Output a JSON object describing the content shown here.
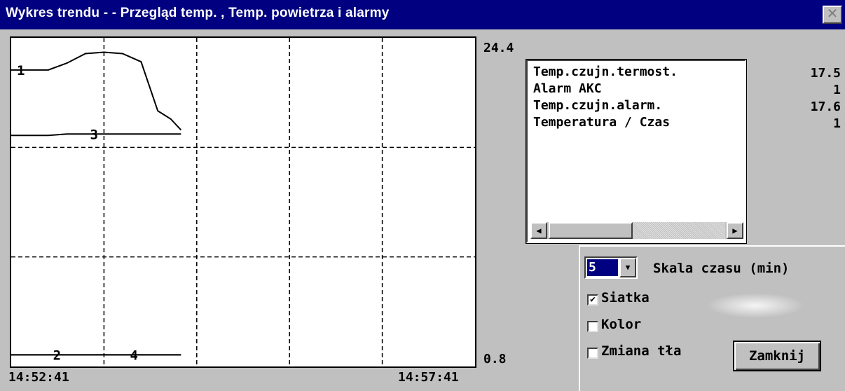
{
  "window": {
    "title": "Wykres trendu -  - Przegląd temp. , Temp. powietrza i alarmy",
    "close_symbol": "✕"
  },
  "chart_data": {
    "type": "line",
    "y_max_label": "24.4",
    "y_min_label": "0.8",
    "ylim": [
      0.8,
      24.4
    ],
    "x_start_label": "14:52:41",
    "x_end_label": "14:57:41",
    "grid": true,
    "x_minutes": [
      0,
      0.2,
      0.4,
      0.6,
      0.8,
      1.0,
      1.2,
      1.4,
      1.5,
      1.58,
      1.65,
      1.72,
      1.83
    ],
    "series": [
      {
        "name": "1",
        "values": [
          22.3,
          22.3,
          22.3,
          22.8,
          23.5,
          23.6,
          23.5,
          22.9,
          20.9,
          19.3,
          19.0,
          18.7,
          17.9
        ]
      },
      {
        "name": "3",
        "values": [
          17.5,
          17.5,
          17.5,
          17.6,
          17.6,
          17.6,
          17.6,
          17.6,
          17.6,
          17.6,
          17.6,
          17.6,
          17.6
        ]
      },
      {
        "name": "2",
        "values": [
          1.4,
          1.4,
          1.4,
          1.4,
          1.4,
          1.4,
          1.4,
          1.4,
          1.4,
          1.4,
          1.4,
          1.4,
          1.4
        ]
      },
      {
        "name": "4",
        "values": [
          1.4,
          1.4,
          1.4,
          1.4,
          1.4,
          1.4,
          1.4,
          1.4,
          1.4,
          1.4,
          1.4,
          1.4,
          1.4
        ]
      }
    ]
  },
  "legend": {
    "items": [
      {
        "label": "Temp.czujn.termost.",
        "value": "17.5"
      },
      {
        "label": "Alarm AKC",
        "value": "1"
      },
      {
        "label": "Temp.czujn.alarm.",
        "value": "17.6"
      },
      {
        "label": "Temperatura / Czas",
        "value": "1"
      }
    ],
    "scroll_left": "◀",
    "scroll_right": "▶"
  },
  "controls": {
    "time_scale_value": "5",
    "time_scale_label": "Skala czasu (min)",
    "dropdown_symbol": "▼",
    "grid_label": "Siatka",
    "grid_checked": true,
    "color_label": "Kolor",
    "color_checked": false,
    "bg_change_label": "Zmiana tła",
    "bg_change_checked": false,
    "close_label": "Zamknij",
    "check_mark": "✔"
  }
}
